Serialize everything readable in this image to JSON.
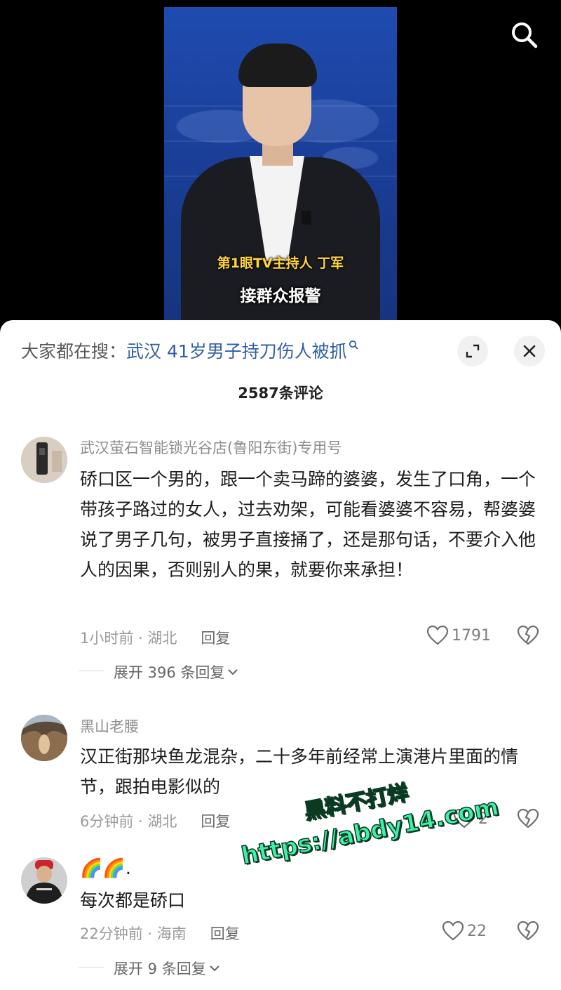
{
  "video": {
    "caption_line1": "第1眼TV主持人 丁军",
    "caption_line2": "接群众报警"
  },
  "sheet": {
    "search_prefix": "大家都在搜：",
    "search_query": "武汉 41岁男子持刀伤人被抓",
    "comment_count_title": "2587条评论"
  },
  "comments": [
    {
      "username": "武汉萤石智能锁光谷店(鲁阳东街)专用号",
      "text": "硚口区一个男的，跟一个卖马蹄的婆婆，发生了口角，一个带孩子路过的女人，过去劝架，可能看婆婆不容易，帮婆婆说了男子几句，被男子直接捅了，还是那句话，不要介入他人的因果，否则别人的果，就要你来承担！",
      "time": "1小时前 · 湖北",
      "reply_label": "回复",
      "likes": "1791",
      "expand_label": "展开 396 条回复"
    },
    {
      "username": "黑山老腰",
      "text": "汉正街那块鱼龙混杂，二十多年前经常上演港片里面的情节，跟拍电影似的",
      "time": "6分钟前 · 湖北",
      "reply_label": "回复",
      "likes": "2"
    },
    {
      "username": "🌈🌈.",
      "text": "每次都是硚口",
      "time": "22分钟前 · 海南",
      "reply_label": "回复",
      "likes": "22",
      "expand_label": "展开 9 条回复"
    }
  ],
  "watermark": {
    "line1": "黑料不打烊",
    "line2": "https://abdy14.com"
  },
  "colors": {
    "link_blue": "#2f5fa8",
    "watermark_green": "#3ff0a8",
    "caption_yellow": "#ffd43b"
  }
}
